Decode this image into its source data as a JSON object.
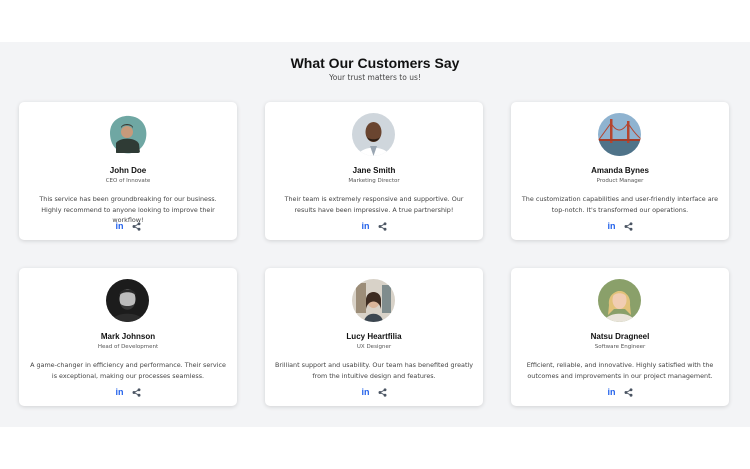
{
  "header": {
    "title": "What Our Customers Say",
    "subtitle": "Your trust matters to us!"
  },
  "testimonials": [
    {
      "name": "John Doe",
      "role": "CEO of Innovate",
      "quote": "This service has been groundbreaking for our business. Highly recommend to anyone looking to improve their workflow!",
      "icons": [
        "linkedin-icon",
        "share-icon"
      ]
    },
    {
      "name": "Jane Smith",
      "role": "Marketing Director",
      "quote": "Their team is extremely responsive and supportive. Our results have been impressive. A true partnership!",
      "icons": [
        "linkedin-icon",
        "share-icon"
      ]
    },
    {
      "name": "Amanda Bynes",
      "role": "Product Manager",
      "quote": "The customization capabilities and user-friendly interface are top-notch. It's transformed our operations.",
      "icons": [
        "linkedin-icon",
        "share-icon"
      ]
    },
    {
      "name": "Mark Johnson",
      "role": "Head of Development",
      "quote": "A game-changer in efficiency and performance. Their service is exceptional, making our processes seamless.",
      "icons": [
        "linkedin-icon",
        "share-icon"
      ]
    },
    {
      "name": "Lucy Heartfilia",
      "role": "UX Designer",
      "quote": "Brilliant support and usability. Our team has benefited greatly from the intuitive design and features.",
      "icons": [
        "linkedin-icon",
        "share-icon"
      ]
    },
    {
      "name": "Natsu Dragneel",
      "role": "Software Engineer",
      "quote": "Efficient, reliable, and innovative. Highly satisfied with the outcomes and improvements in our project management.",
      "icons": [
        "linkedin-icon",
        "share-icon"
      ]
    }
  ],
  "linkedin_glyph": "in",
  "colors": {
    "section_bg": "#f3f4f6",
    "card_bg": "#ffffff",
    "linkedin_blue": "#2563eb",
    "share_gray": "#4b5563"
  }
}
